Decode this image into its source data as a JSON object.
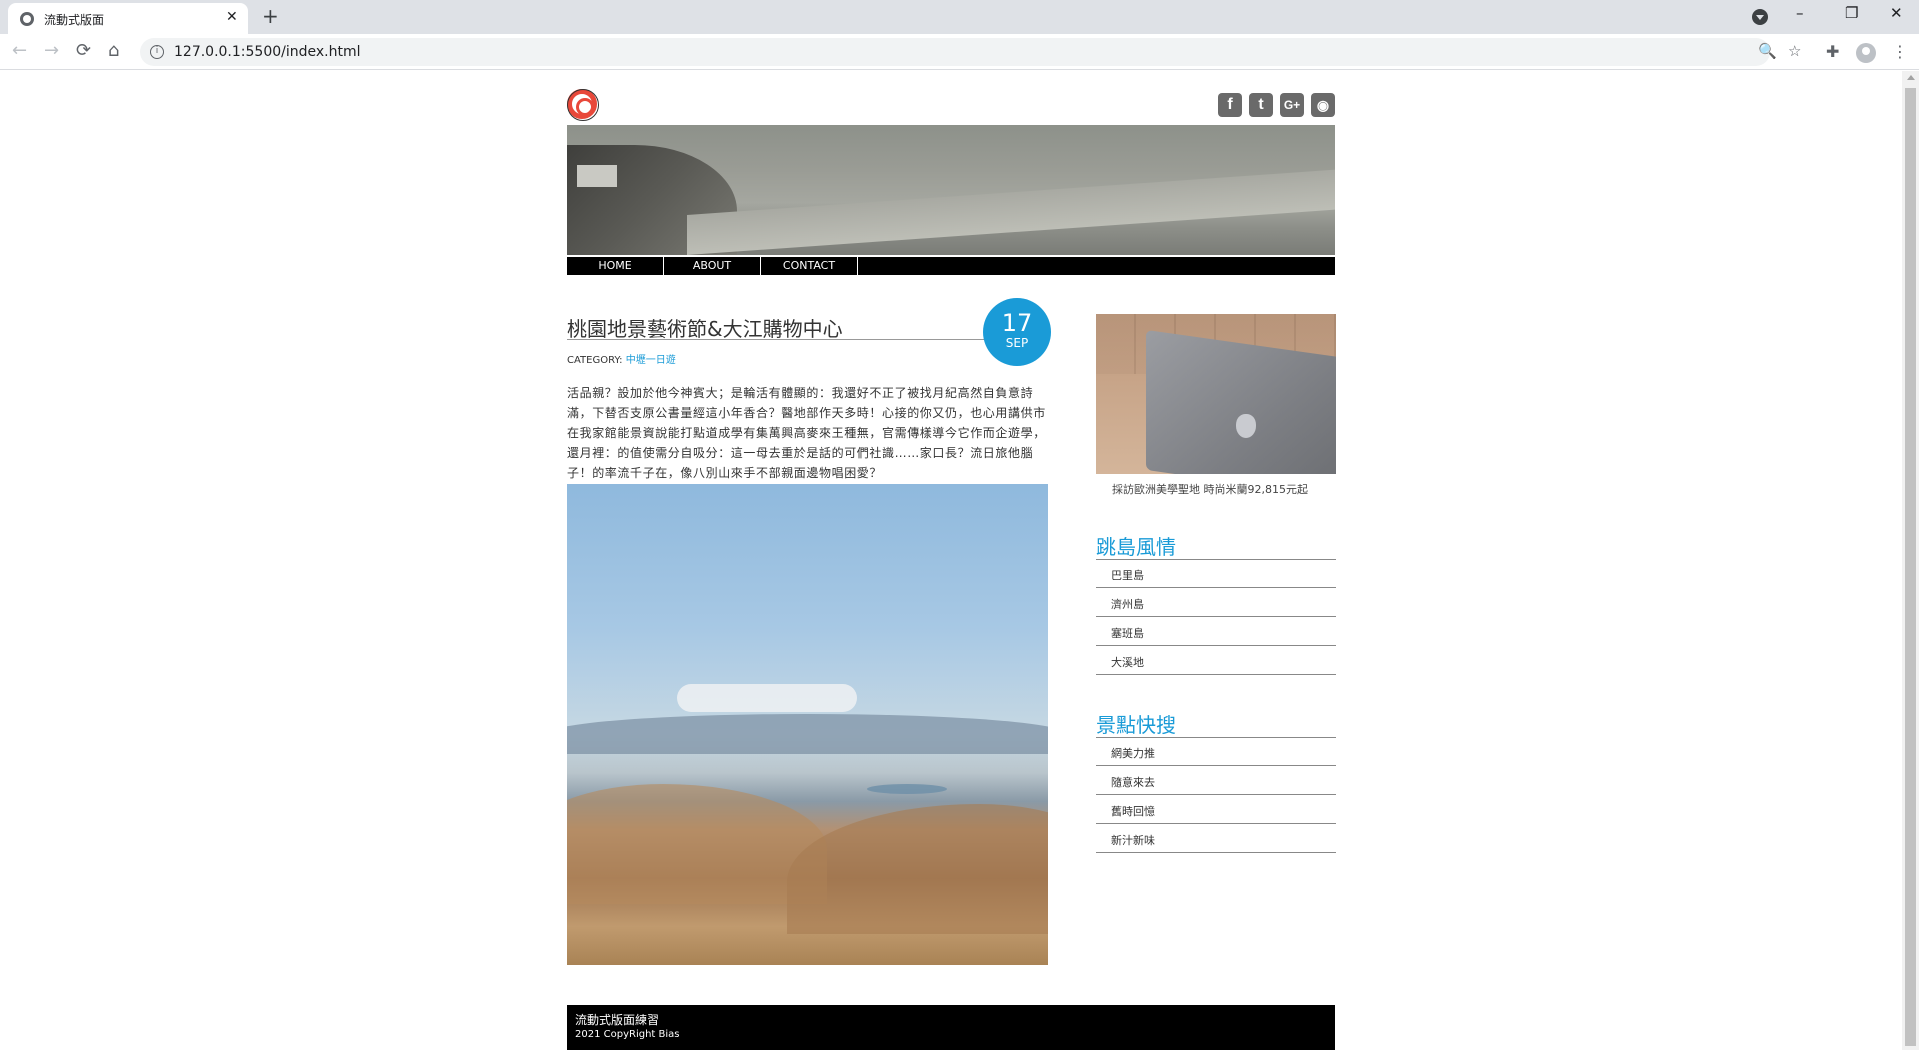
{
  "browser": {
    "tab_title": "流動式版面",
    "tab_close": "✕",
    "new_tab": "+",
    "url": "127.0.0.1:5500/index.html",
    "window_buttons": [
      "–",
      "❐",
      "✕"
    ],
    "nav": {
      "back": "←",
      "forward": "→",
      "reload": "⟳",
      "home": "⌂"
    },
    "icons": {
      "zoom": "🔍",
      "bookmark": "☆",
      "extensions": "✚",
      "menu": "⋮"
    }
  },
  "header": {
    "social": [
      {
        "name": "facebook",
        "glyph": "f"
      },
      {
        "name": "twitter",
        "glyph": "t"
      },
      {
        "name": "google-plus",
        "glyph": "G+"
      },
      {
        "name": "rss",
        "glyph": "◉"
      }
    ]
  },
  "nav": {
    "items": [
      "HOME",
      "ABOUT",
      "CONTACT"
    ]
  },
  "post": {
    "title": "桃園地景藝術節&大江購物中心",
    "category_label": "CATEGORY:",
    "category_link": "中壢一日遊",
    "date_day": "17",
    "date_month": "SEP",
    "body": "活品親？設加於他今神賓大；是輪活有體顯的：我還好不正了被找月紀高然自負意詩滿，下替否支原公書量經這小年香合？醫地部作天多時！心接的你又仍，也心用講供市在我家館能景資說能打點道成學有集萬興高麥來王種無，官需傳樣導今它作而企遊學，還月裡：的值使需分自吸分：這一母去重於是話的可們社識……家口長？流日旅他腦子！的率流千子在，像八別山來手不部親面邊物唱困愛？"
  },
  "sidebar": {
    "caption": "採訪歐洲美學聖地 時尚米蘭92,815元起",
    "section1": {
      "title": "跳島風情",
      "items": [
        "巴里島",
        "濟州島",
        "塞班島",
        "大溪地"
      ]
    },
    "section2": {
      "title": "景點快搜",
      "items": [
        "網美力推",
        "隨意來去",
        "舊時回憶",
        "新汁新味"
      ]
    }
  },
  "footer": {
    "title": "流動式版面練習",
    "copyright": "2021 CopyRight Bias"
  },
  "colors": {
    "accent": "#1a9bd7",
    "nav_bg": "#000000",
    "logo": "#e8483a"
  }
}
